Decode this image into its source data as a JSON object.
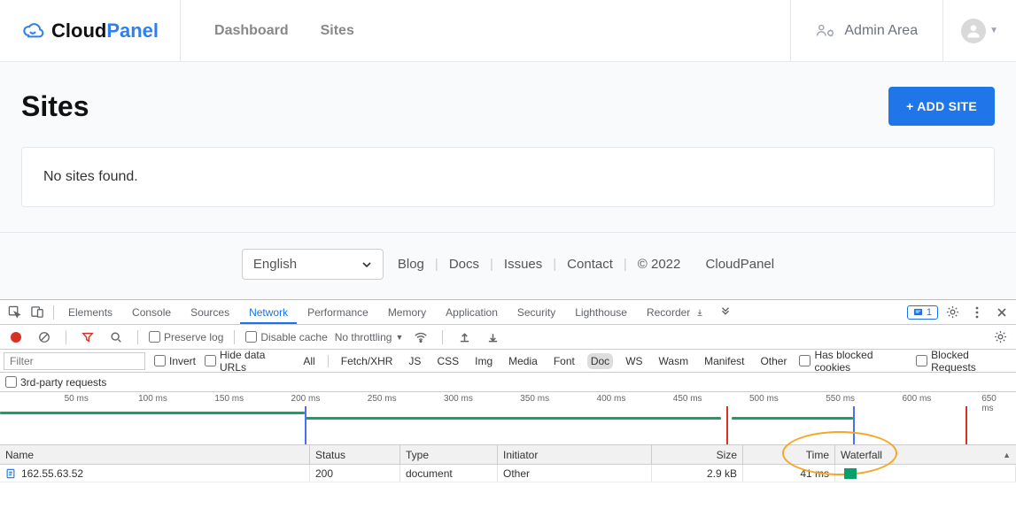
{
  "brand": {
    "cloud": "Cloud",
    "panel": "Panel"
  },
  "nav": {
    "dashboard": "Dashboard",
    "sites": "Sites"
  },
  "adminArea": "Admin Area",
  "page": {
    "title": "Sites",
    "addBtn": "+ ADD SITE",
    "empty": "No sites found."
  },
  "footer": {
    "language": "English",
    "links": {
      "blog": "Blog",
      "docs": "Docs",
      "issues": "Issues",
      "contact": "Contact"
    },
    "copyright": "© 2022",
    "product": "CloudPanel"
  },
  "devtools": {
    "tabs": {
      "elements": "Elements",
      "console": "Console",
      "sources": "Sources",
      "network": "Network",
      "performance": "Performance",
      "memory": "Memory",
      "application": "Application",
      "security": "Security",
      "lighthouse": "Lighthouse",
      "recorder": "Recorder"
    },
    "issuesCount": "1",
    "toolbar": {
      "preserveLog": "Preserve log",
      "disableCache": "Disable cache",
      "throttling": "No throttling"
    },
    "filter": {
      "placeholder": "Filter",
      "invert": "Invert",
      "hideDataUrls": "Hide data URLs",
      "types": {
        "all": "All",
        "fetch": "Fetch/XHR",
        "js": "JS",
        "css": "CSS",
        "img": "Img",
        "media": "Media",
        "font": "Font",
        "doc": "Doc",
        "ws": "WS",
        "wasm": "Wasm",
        "manifest": "Manifest",
        "other": "Other"
      },
      "hasBlocked": "Has blocked cookies",
      "blockedReq": "Blocked Requests",
      "thirdParty": "3rd-party requests"
    },
    "timeline": {
      "ticks": [
        "50 ms",
        "100 ms",
        "150 ms",
        "200 ms",
        "250 ms",
        "300 ms",
        "350 ms",
        "400 ms",
        "450 ms",
        "500 ms",
        "550 ms",
        "600 ms",
        "650 ms"
      ]
    },
    "grid": {
      "headers": {
        "name": "Name",
        "status": "Status",
        "type": "Type",
        "initiator": "Initiator",
        "size": "Size",
        "time": "Time",
        "waterfall": "Waterfall"
      },
      "row": {
        "name": "162.55.63.52",
        "status": "200",
        "type": "document",
        "initiator": "Other",
        "size": "2.9 kB",
        "time": "41 ms"
      }
    }
  }
}
